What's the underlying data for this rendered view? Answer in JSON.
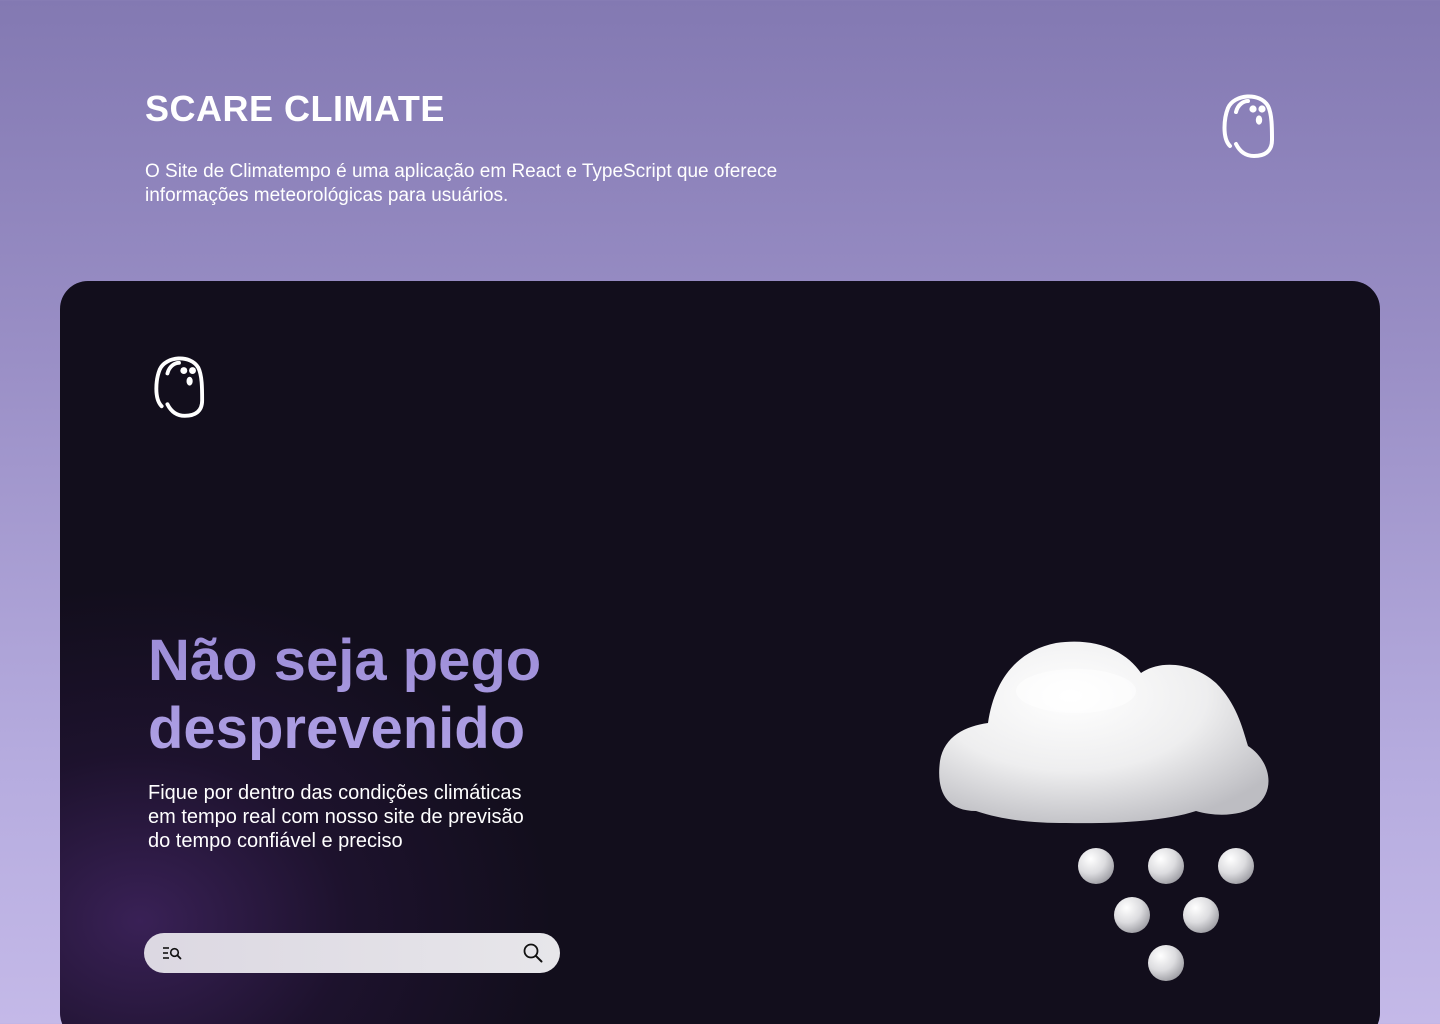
{
  "header": {
    "title": "SCARE CLIMATE",
    "description": "O Site de Climatempo é uma aplicação em React e TypeScript que oferece\n informações meteorológicas para usuários.",
    "logo_icon": "ghost-logo-icon"
  },
  "app": {
    "logo_icon": "ghost-logo-icon",
    "headline": "Não seja pego\ndesprevenido",
    "subtext": "Fique por dentro das condições climáticas\nem tempo real  com nosso site de previsão\ndo tempo confiável e preciso",
    "search": {
      "placeholder": "",
      "value": "",
      "filter_icon": "filter-search-icon",
      "search_icon": "search-icon"
    },
    "illustration": {
      "icon": "cloud-hail-icon"
    }
  },
  "colors": {
    "page_gradient_top": "#8379b2",
    "page_gradient_bottom": "#c4b9e8",
    "card_background": "#120e1c",
    "headline_accent": "#a393dd",
    "text_primary": "#ffffff"
  }
}
